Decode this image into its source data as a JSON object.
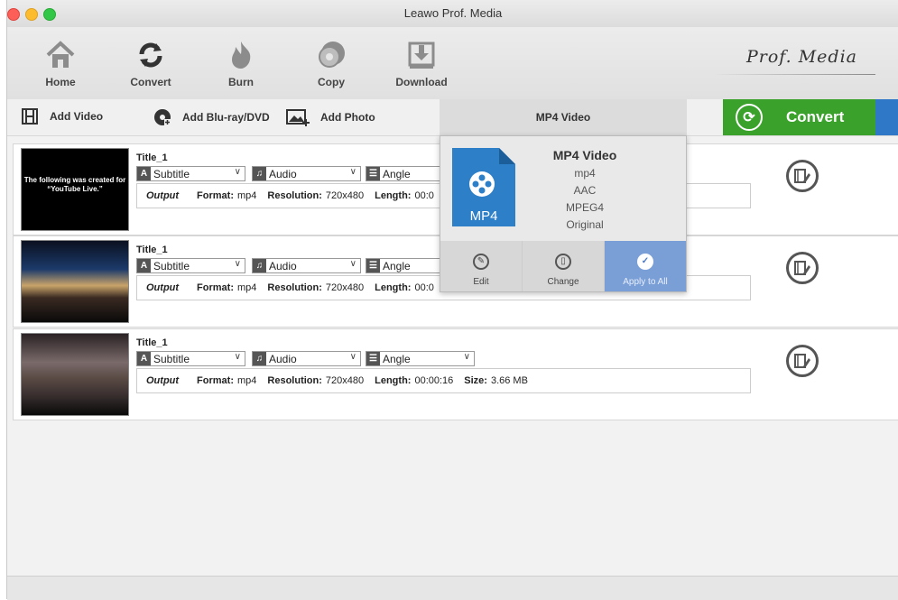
{
  "window": {
    "title": "Leawo Prof. Media"
  },
  "toolbar": {
    "items": [
      {
        "label": "Home",
        "icon": "home-icon"
      },
      {
        "label": "Convert",
        "icon": "convert-icon"
      },
      {
        "label": "Burn",
        "icon": "burn-icon"
      },
      {
        "label": "Copy",
        "icon": "copy-icon"
      },
      {
        "label": "Download",
        "icon": "download-icon"
      }
    ],
    "brand": "Prof. Media"
  },
  "actions": {
    "add_video": "Add Video",
    "add_bluray": "Add Blu-ray/DVD",
    "add_photo": "Add Photo",
    "profile": "MP4 Video",
    "convert": "Convert"
  },
  "rows": [
    {
      "title": "Title_1",
      "subtitle": "Subtitle",
      "audio": "Audio",
      "angle": "Angle",
      "output": "Output",
      "format_label": "Format:",
      "format": "mp4",
      "resolution_label": "Resolution:",
      "resolution": "720x480",
      "length_label": "Length:",
      "length": "00:0",
      "size_label": "",
      "size": "",
      "thumb_text": "The following was created for “YouTube Live.”"
    },
    {
      "title": "Title_1",
      "subtitle": "Subtitle",
      "audio": "Audio",
      "angle": "Angle",
      "output": "Output",
      "format_label": "Format:",
      "format": "mp4",
      "resolution_label": "Resolution:",
      "resolution": "720x480",
      "length_label": "Length:",
      "length": "00:0",
      "size_label": "",
      "size": "",
      "thumb_text": ""
    },
    {
      "title": "Title_1",
      "subtitle": "Subtitle",
      "audio": "Audio",
      "angle": "Angle",
      "output": "Output",
      "format_label": "Format:",
      "format": "mp4",
      "resolution_label": "Resolution:",
      "resolution": "720x480",
      "length_label": "Length:",
      "length": "00:00:16",
      "size_label": "Size:",
      "size": "3.66 MB",
      "thumb_text": ""
    }
  ],
  "popup": {
    "file_label": "MP4",
    "name": "MP4 Video",
    "container": "mp4",
    "audio_codec": "AAC",
    "video_codec": "MPEG4",
    "quality": "Original",
    "edit": "Edit",
    "change": "Change",
    "apply": "Apply to All"
  },
  "colors": {
    "convert_green": "#3aa22b",
    "accent_blue": "#2f78c8",
    "apply_blue": "#7a9ed6"
  }
}
